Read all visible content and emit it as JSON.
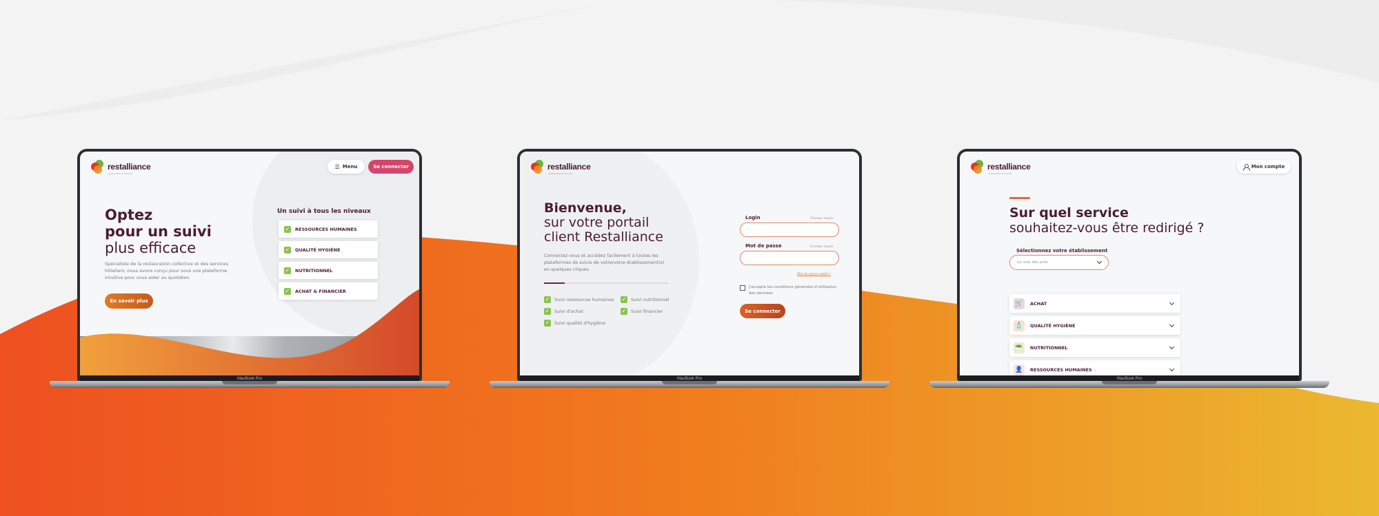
{
  "colors": {
    "brand_dark": "#4a1d2f",
    "accent_orange": "#f06a1f",
    "accent_yellow": "#ebb830",
    "accent_pink": "#d6446a",
    "check_green": "#8cc152"
  },
  "device_label": "MacBook Pro",
  "brand": {
    "name": "restalliance",
    "tagline": "restauration & services"
  },
  "screen1": {
    "menu_label": "Menu",
    "login_label": "Se connecter",
    "headline_bold_1": "Optez",
    "headline_bold_2": "pour un suivi",
    "headline_light": "plus efficace",
    "description": "Spécialiste de la restauration collective et des services hôteliers, nous avons conçu pour vous une plateforme intuitive pour vous aider au quotidien.",
    "cta_label": "En savoir plus",
    "levels_title": "Un suivi à tous les niveaux",
    "levels": [
      {
        "label": "RESSOURCES HUMAINES"
      },
      {
        "label": "QUALITÉ HYGIÈNE"
      },
      {
        "label": "NUTRITIONNEL"
      },
      {
        "label": "ACHAT & FINANCIER"
      }
    ]
  },
  "screen2": {
    "headline_bold": "Bienvenue,",
    "headline_light_1": "sur votre portail",
    "headline_light_2": "client Restalliance",
    "description": "Connectez-vous et accédez facilement à toutes les plateformes de suivis de votre/votre établissement(s) en quelques cliques.",
    "features": [
      "Suivi ressources humaines",
      "Suivi nutritionnel",
      "Suivi d'achat",
      "Suivi financier",
      "Suivi qualité d'hygiène"
    ],
    "login_label": "Login",
    "password_label": "Mot de passe",
    "required_note": "Champs requis",
    "forgot_label": "Mot de passe oublié ?",
    "cgu_label": "J'accepte les conditions générales d'utilisation des données",
    "submit_label": "Se connecter"
  },
  "screen3": {
    "account_label": "Mon compte",
    "headline_bold": "Sur quel service",
    "headline_light": "souhaitez-vous être redirigé ?",
    "select_label": "Sélectionnez votre établissement",
    "select_value": "La rose des prés",
    "services": [
      {
        "label": "ACHAT",
        "icon": "cart-icon",
        "color": "#e6d9de"
      },
      {
        "label": "QUALITÉ HYGIÈNE",
        "icon": "bottle-icon",
        "color": "#fde0d0"
      },
      {
        "label": "NUTRITIONNEL",
        "icon": "food-icon",
        "color": "#e2f0d3"
      },
      {
        "label": "RESSOURCES HUMAINES",
        "icon": "person-icon",
        "color": "#fbe0e6"
      }
    ]
  }
}
